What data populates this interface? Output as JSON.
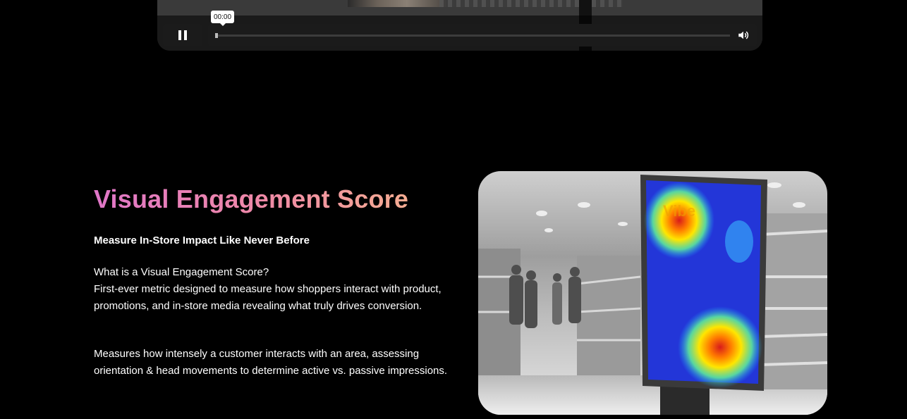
{
  "video_player": {
    "current_time": "00:00",
    "progress": 0,
    "state": "playing",
    "icons": {
      "pause": "pause-icon",
      "volume": "volume-icon"
    }
  },
  "section": {
    "title": "Visual Engagement Score",
    "subtitle": "Measure In-Store Impact Like Never Before",
    "paragraph_1_lines": [
      "What is a Visual Engagement Score?",
      "First-ever metric designed to measure how shoppers interact with product, promotions, and in-store media revealing what truly drives conversion."
    ],
    "paragraph_2": "Measures how intensely a customer interacts with an area, assessing orientation & head movements to determine active vs. passive impressions.",
    "title_gradient": [
      "#e076c8",
      "#f5ac92"
    ]
  },
  "image": {
    "subject": "heatmap-display-in-supermarket",
    "screen_text": "Vibe"
  }
}
